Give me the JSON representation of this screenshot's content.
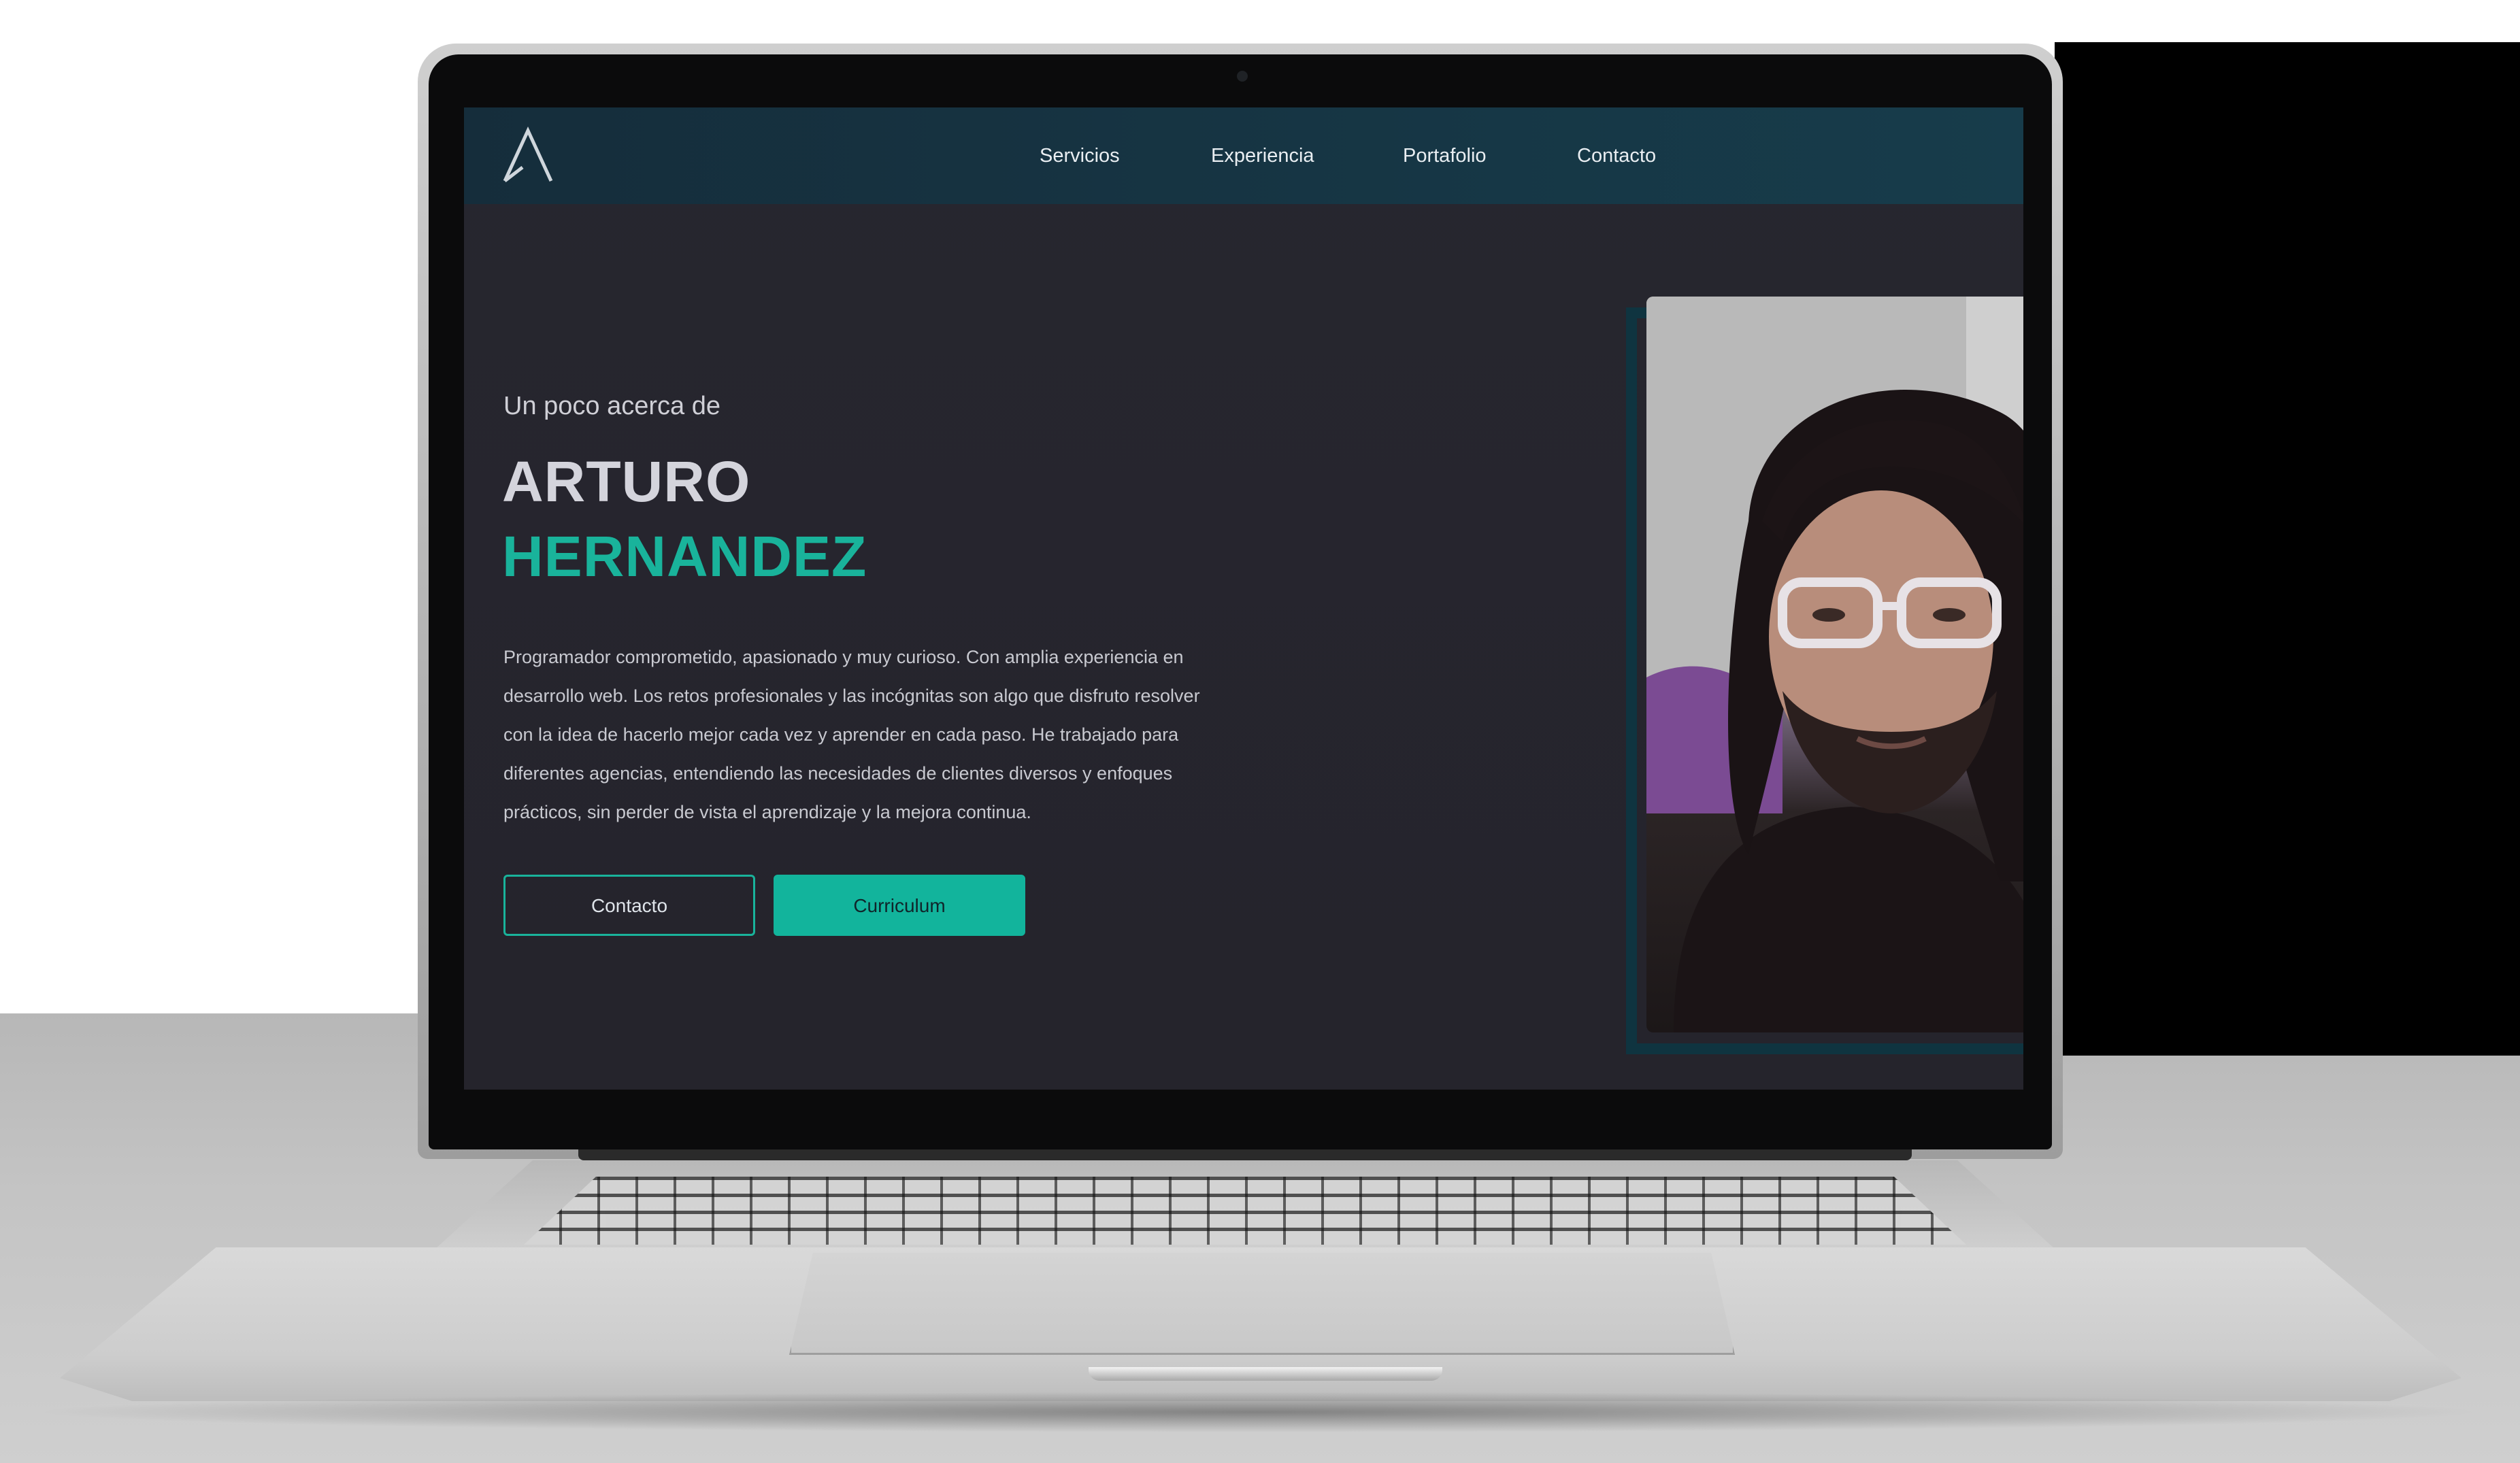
{
  "nav": {
    "items": [
      "Servicios",
      "Experiencia",
      "Portafolio",
      "Contacto"
    ]
  },
  "hero": {
    "subtitle": "Un poco acerca de",
    "first_name": "ARTURO",
    "last_name": "HERNANDEZ",
    "bio": "Programador comprometido, apasionado y muy curioso. Con amplia experiencia en desarrollo web. Los retos profesionales y las incógnitas son algo que disfruto resolver con la idea de hacerlo mejor cada vez y aprender en cada paso. He trabajado para diferentes agencias, entendiendo las necesidades de clientes diversos y enfoques prácticos, sin perder de vista el aprendizaje y la mejora continua.",
    "buttons": {
      "contact": "Contacto",
      "resume": "Curriculum"
    }
  },
  "icons": {
    "logo": "triangle-logo-icon",
    "camera": "webcam-icon"
  },
  "colors": {
    "accent": "#19b39b",
    "navbar": "#173c4b",
    "background": "#25242c",
    "text": "#cfcfd6"
  }
}
